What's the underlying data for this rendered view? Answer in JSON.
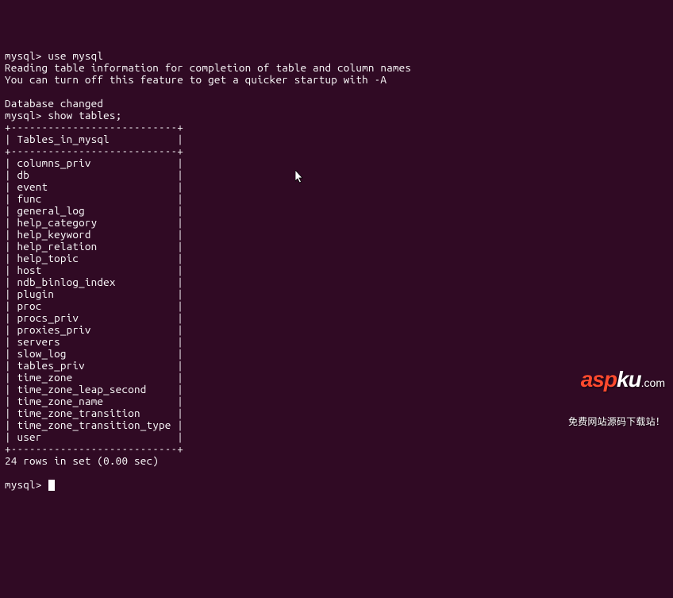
{
  "terminal": {
    "prompt": "mysql>",
    "commands": {
      "cmd1": "use mysql",
      "cmd2": "show tables;"
    },
    "messages": {
      "reading": "Reading table information for completion of table and column names",
      "turnoff": "You can turn off this feature to get a quicker startup with -A",
      "changed": "Database changed"
    },
    "table": {
      "border_top": "+---------------------------+",
      "header": "| Tables_in_mysql           |",
      "rows": [
        "| columns_priv              |",
        "| db                        |",
        "| event                     |",
        "| func                      |",
        "| general_log               |",
        "| help_category             |",
        "| help_keyword              |",
        "| help_relation             |",
        "| help_topic                |",
        "| host                      |",
        "| ndb_binlog_index          |",
        "| plugin                    |",
        "| proc                      |",
        "| procs_priv                |",
        "| proxies_priv              |",
        "| servers                   |",
        "| slow_log                  |",
        "| tables_priv               |",
        "| time_zone                 |",
        "| time_zone_leap_second     |",
        "| time_zone_name            |",
        "| time_zone_transition      |",
        "| time_zone_transition_type |",
        "| user                      |"
      ]
    },
    "result": "24 rows in set (0.00 sec)"
  },
  "watermark": {
    "asp": "asp",
    "ku": "ku",
    "com": ".com",
    "subtitle": "免费网站源码下载站！"
  }
}
